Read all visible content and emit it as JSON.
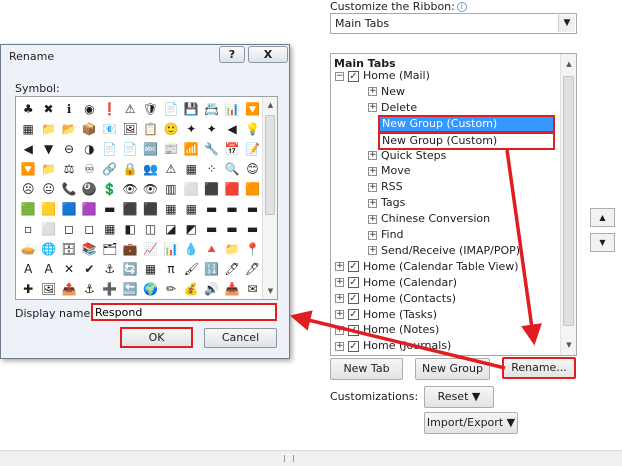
{
  "ribbon": {
    "label": "Customize the Ribbon:",
    "info_icon": "i",
    "select_value": "Main Tabs",
    "tree_header": "Main Tabs",
    "tree": [
      {
        "label": "Home (Mail)",
        "expander": "−",
        "checked": true,
        "level": 0
      },
      {
        "label": "New",
        "expander": "+",
        "checked": false,
        "level": 1
      },
      {
        "label": "Delete",
        "expander": "+",
        "checked": false,
        "level": 1
      },
      {
        "label": "Quick Steps",
        "expander": "+",
        "checked": false,
        "level": 1
      },
      {
        "label": "Move",
        "expander": "+",
        "checked": false,
        "level": 1
      },
      {
        "label": "RSS",
        "expander": "+",
        "checked": false,
        "level": 1
      },
      {
        "label": "Tags",
        "expander": "+",
        "checked": false,
        "level": 1
      },
      {
        "label": "Chinese Conversion",
        "expander": "+",
        "checked": false,
        "level": 1
      },
      {
        "label": "Find",
        "expander": "+",
        "checked": false,
        "level": 1
      },
      {
        "label": "Send/Receive (IMAP/POP)",
        "expander": "+",
        "checked": false,
        "level": 1
      },
      {
        "label": "Home (Calendar Table View)",
        "expander": "+",
        "checked": true,
        "level": 0
      },
      {
        "label": "Home (Calendar)",
        "expander": "+",
        "checked": true,
        "level": 0
      },
      {
        "label": "Home (Contacts)",
        "expander": "+",
        "checked": true,
        "level": 0
      },
      {
        "label": "Home (Tasks)",
        "expander": "+",
        "checked": true,
        "level": 0
      },
      {
        "label": "Home (Notes)",
        "expander": "+",
        "checked": true,
        "level": 0
      },
      {
        "label": "Home (Journals)",
        "expander": "+",
        "checked": true,
        "level": 0
      }
    ],
    "new_group_selected": "New Group (Custom)",
    "new_group_other": "New Group (Custom)",
    "new_tab_label": "New Tab",
    "new_group_label": "New Group",
    "rename_label": "Rename...",
    "customizations_label": "Customizations:",
    "reset_label": "Reset ▼",
    "import_export_label": "Import/Export ▼",
    "up_arrow": "▲",
    "down_arrow": "▼",
    "dropdown_arrow": "▼"
  },
  "dialog": {
    "title": "Rename",
    "help": "?",
    "close": "X",
    "symbol_label": "Symbol:",
    "display_name_label": "Display name:",
    "display_name_value": "Respond",
    "ok_label": "OK",
    "cancel_label": "Cancel",
    "symbols": [
      "♣",
      "✖",
      "ℹ",
      "◉",
      "❗",
      "⚠",
      "🛡",
      "📄",
      "💾",
      "📇",
      "📊",
      "🔽",
      "▦",
      "📁",
      "📂",
      "📦",
      "📧",
      "🖼",
      "📋",
      "🙂",
      "✦",
      "✦",
      "◀",
      "💡",
      "◀",
      "▼",
      "⊖",
      "◑",
      "📄",
      "📄",
      "🔤",
      "📰",
      "📶",
      "🔧",
      "📅",
      "📝",
      "🔽",
      "📁",
      "⚖",
      "♾",
      "🔗",
      "🔒",
      "👥",
      "⚠",
      "▦",
      "⁘",
      "🔍",
      "😊",
      "☹",
      "😐",
      "📞",
      "🎱",
      "💲",
      "👁",
      "👁",
      "▥",
      "⬜",
      "⬛",
      "🟥",
      "🟧",
      "🟩",
      "🟨",
      "🟦",
      "🟪",
      "▬",
      "⬛",
      "⬛",
      "▦",
      "▦",
      "▬",
      "▬",
      "▬",
      "▫",
      "⬜",
      "◻",
      "◻",
      "▦",
      "◧",
      "◫",
      "◪",
      "◩",
      "▬",
      "▬",
      "▬",
      "🥧",
      "🌐",
      "🗄",
      "📚",
      "🗂",
      "💼",
      "📈",
      "📊",
      "💧",
      "🔺",
      "📁",
      "📍",
      "A",
      "A",
      "✕",
      "✔",
      "⚓",
      "🔄",
      "▦",
      "π",
      "🖌",
      "🔢",
      "🖊",
      "🖊",
      "✚",
      "🖼",
      "📤",
      "⚓",
      "➕",
      "🔙",
      "🌍",
      "✏",
      "💰",
      "🔊",
      "📥",
      "✉"
    ]
  },
  "colors": {
    "highlight": "#e01e22",
    "selection": "#3399ff"
  }
}
